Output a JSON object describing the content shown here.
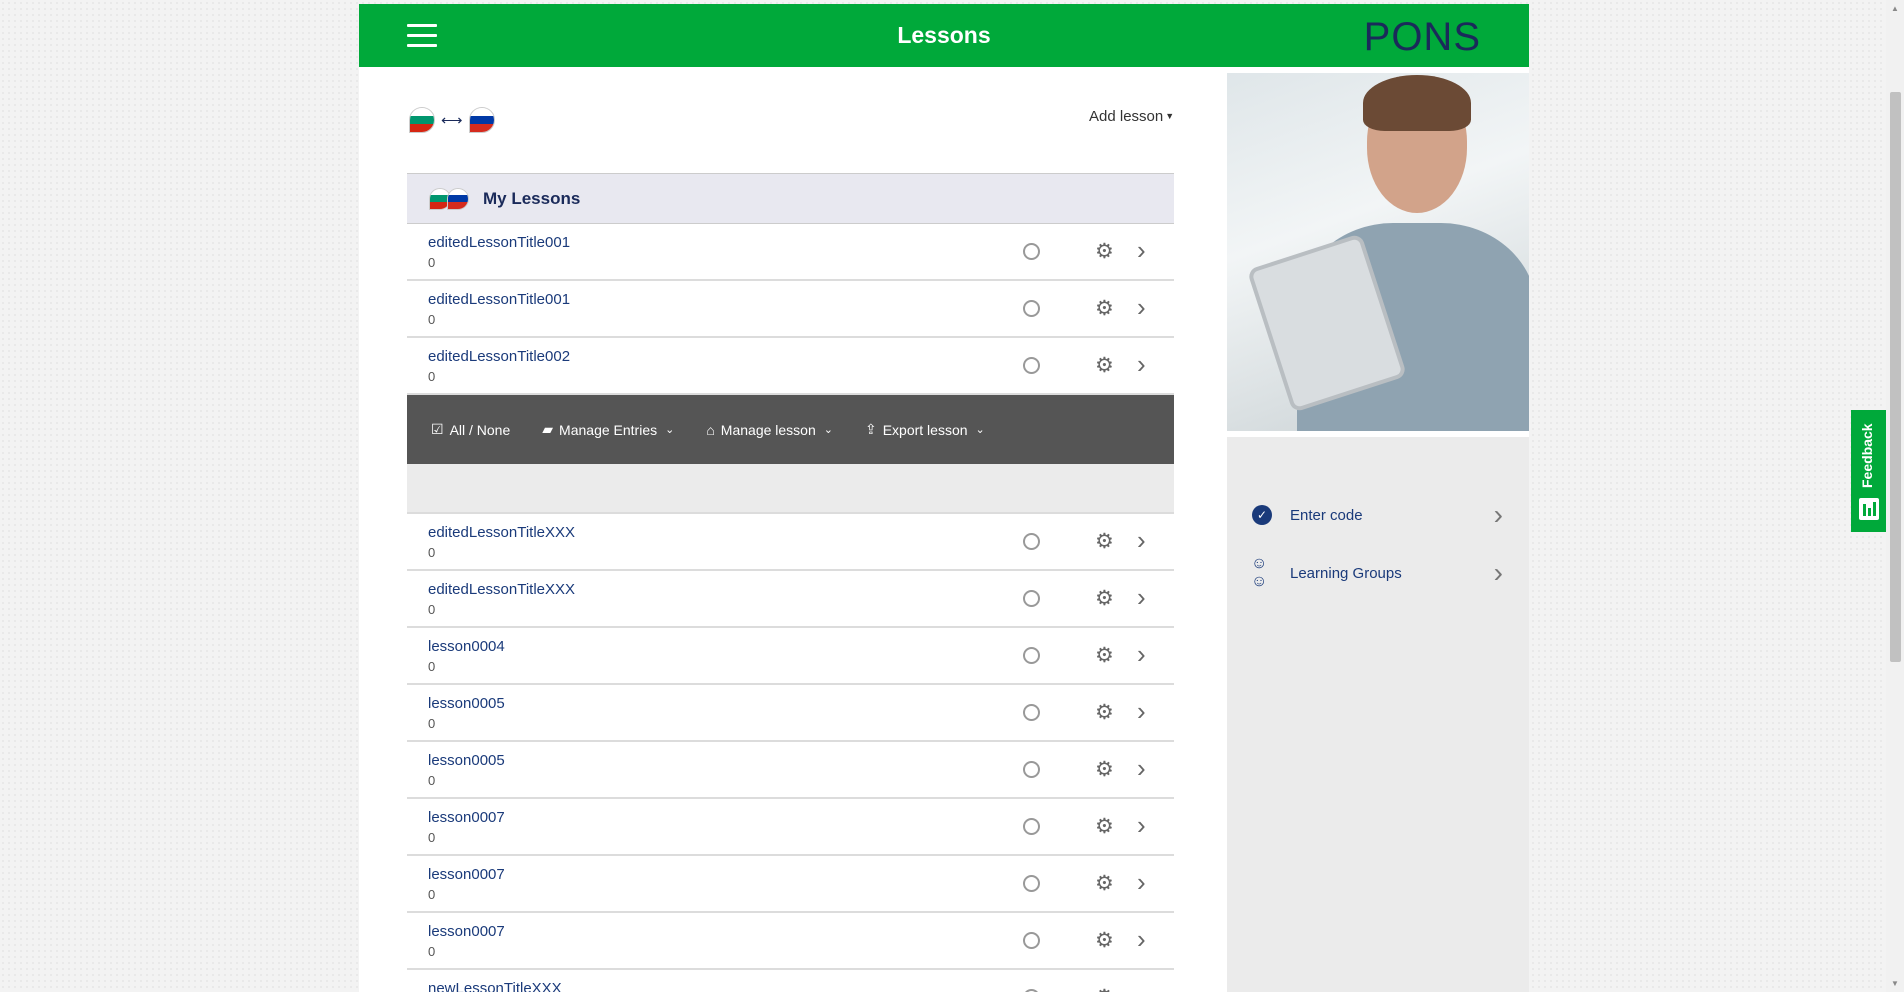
{
  "header": {
    "title": "Lessons",
    "logo": "PONS"
  },
  "toolbar_top": {
    "add_lesson": "Add lesson"
  },
  "section": {
    "title": "My Lessons"
  },
  "lessons_before": [
    {
      "title": "editedLessonTitle001",
      "count": "0"
    },
    {
      "title": "editedLessonTitle001",
      "count": "0"
    },
    {
      "title": "editedLessonTitle002",
      "count": "0"
    }
  ],
  "bulk_actions": {
    "select": "All / None",
    "manage_entries": "Manage Entries",
    "manage_lesson": "Manage lesson",
    "export_lesson": "Export lesson"
  },
  "lessons_after": [
    {
      "title": "editedLessonTitleXXX",
      "count": "0"
    },
    {
      "title": "editedLessonTitleXXX",
      "count": "0"
    },
    {
      "title": "lesson0004",
      "count": "0"
    },
    {
      "title": "lesson0005",
      "count": "0"
    },
    {
      "title": "lesson0005",
      "count": "0"
    },
    {
      "title": "lesson0007",
      "count": "0"
    },
    {
      "title": "lesson0007",
      "count": "0"
    },
    {
      "title": "lesson0007",
      "count": "0"
    },
    {
      "title": "newLessonTitleXXX",
      "count": ""
    }
  ],
  "sidebar": {
    "items": [
      {
        "label": "Enter code",
        "icon": "check-circle-icon"
      },
      {
        "label": "Learning Groups",
        "icon": "group-icon"
      }
    ]
  },
  "feedback": {
    "label": "Feedback"
  },
  "colors": {
    "brand_green": "#00a93a",
    "navy": "#1a2a5a",
    "toolbar_gray": "#555555"
  }
}
